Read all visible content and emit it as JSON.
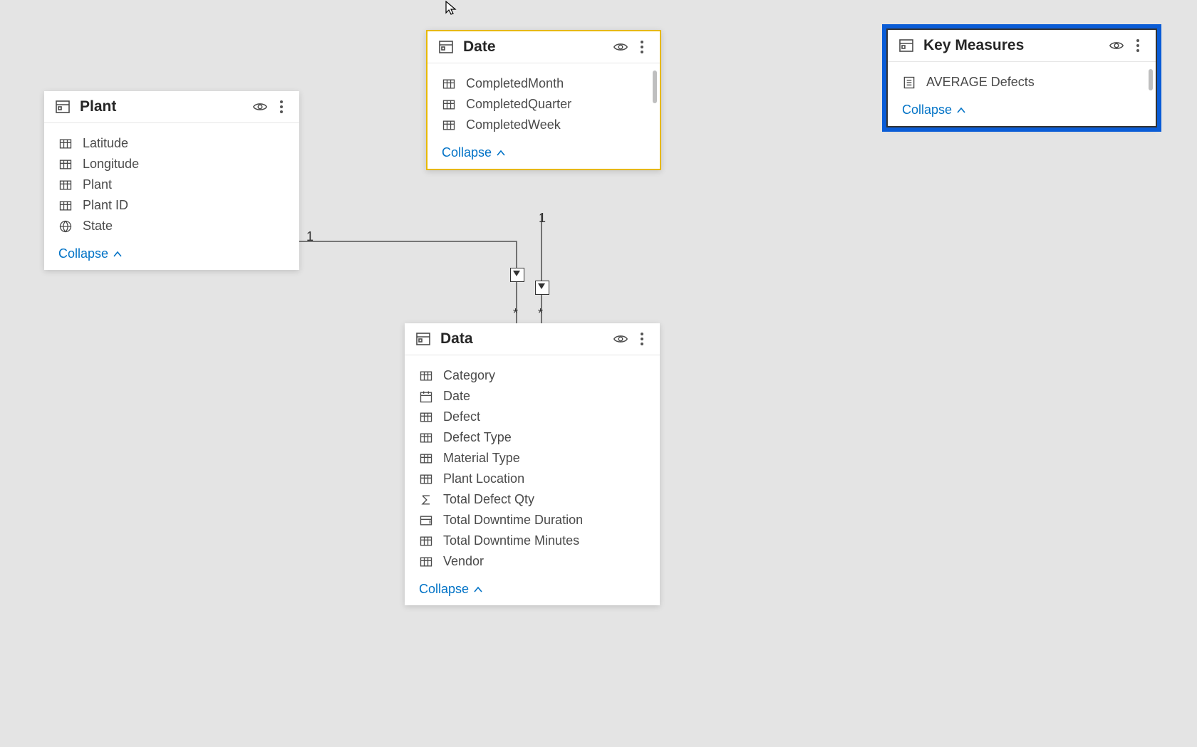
{
  "collapse_label": "Collapse",
  "tables": {
    "plant": {
      "title": "Plant",
      "fields": [
        {
          "icon": "column",
          "name": "Latitude"
        },
        {
          "icon": "column",
          "name": "Longitude"
        },
        {
          "icon": "column",
          "name": "Plant"
        },
        {
          "icon": "column",
          "name": "Plant ID"
        },
        {
          "icon": "globe",
          "name": "State"
        }
      ]
    },
    "date": {
      "title": "Date",
      "fields": [
        {
          "icon": "column",
          "name": "CompletedMonth"
        },
        {
          "icon": "column",
          "name": "CompletedQuarter"
        },
        {
          "icon": "column",
          "name": "CompletedWeek"
        }
      ]
    },
    "data": {
      "title": "Data",
      "fields": [
        {
          "icon": "column",
          "name": "Category"
        },
        {
          "icon": "date",
          "name": "Date"
        },
        {
          "icon": "column",
          "name": "Defect"
        },
        {
          "icon": "column",
          "name": "Defect Type"
        },
        {
          "icon": "column",
          "name": "Material Type"
        },
        {
          "icon": "column",
          "name": "Plant Location"
        },
        {
          "icon": "sigma",
          "name": "Total Defect Qty"
        },
        {
          "icon": "hierarchy",
          "name": "Total Downtime Duration"
        },
        {
          "icon": "column",
          "name": "Total Downtime Minutes"
        },
        {
          "icon": "column",
          "name": "Vendor"
        }
      ]
    },
    "key_measures": {
      "title": "Key Measures",
      "fields": [
        {
          "icon": "measure",
          "name": "AVERAGE Defects"
        }
      ]
    }
  },
  "relationships": {
    "plant_to_data": {
      "from_cardinality": "1",
      "to_cardinality": "*"
    },
    "date_to_data": {
      "from_cardinality": "1",
      "to_cardinality": "*"
    }
  }
}
